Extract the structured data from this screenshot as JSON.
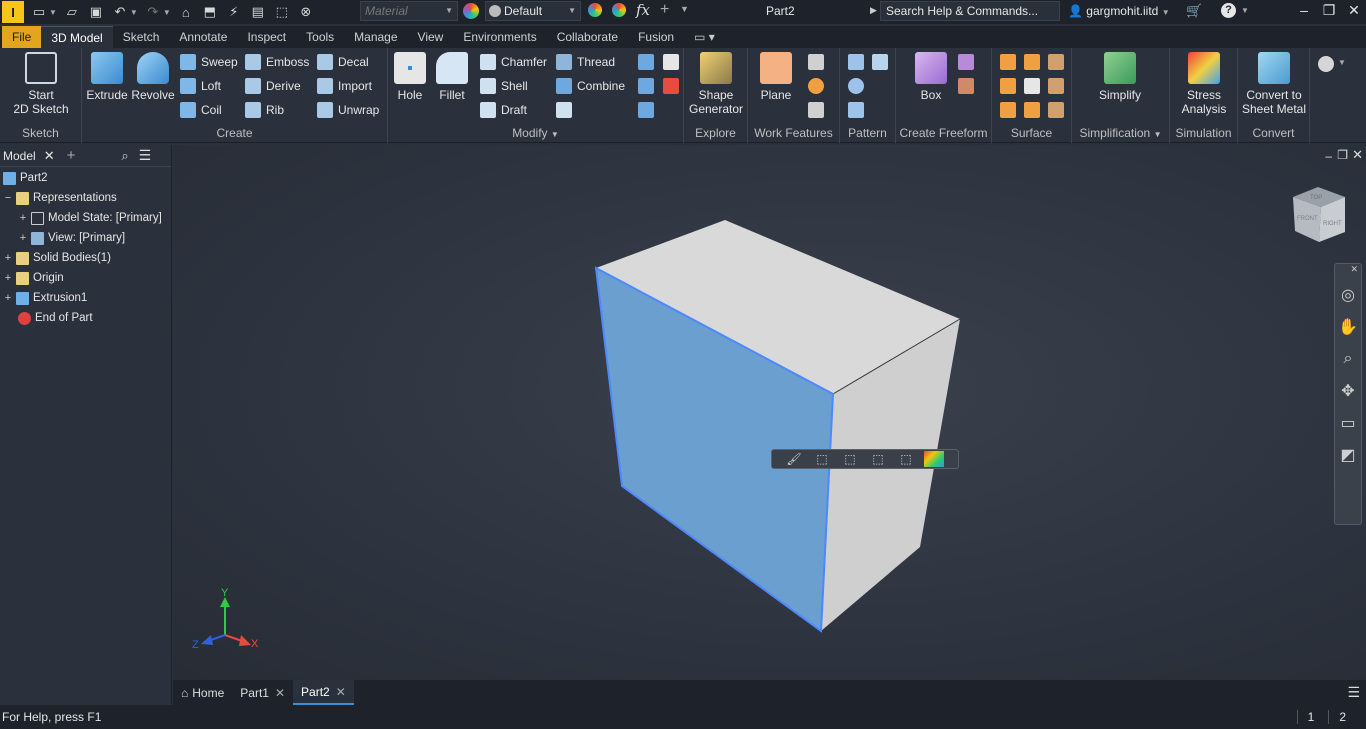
{
  "titlebar": {
    "material_placeholder": "Material",
    "appearance": "Default",
    "doc_title": "Part2",
    "search": "Search Help & Commands...",
    "user": "gargmohit.iitd",
    "fx": "fx"
  },
  "tabs": [
    "File",
    "3D Model",
    "Sketch",
    "Annotate",
    "Inspect",
    "Tools",
    "Manage",
    "View",
    "Environments",
    "Collaborate",
    "Fusion"
  ],
  "ribbon": {
    "sketch": {
      "label": "Sketch",
      "start": "Start",
      "sketch2d": "2D Sketch"
    },
    "create": {
      "label": "Create",
      "extrude": "Extrude",
      "revolve": "Revolve",
      "sweep": "Sweep",
      "loft": "Loft",
      "coil": "Coil",
      "emboss": "Emboss",
      "derive": "Derive",
      "rib": "Rib",
      "decal": "Decal",
      "import": "Import",
      "unwrap": "Unwrap"
    },
    "modify": {
      "label": "Modify",
      "hole": "Hole",
      "fillet": "Fillet",
      "chamfer": "Chamfer",
      "shell": "Shell",
      "draft": "Draft",
      "thread": "Thread",
      "combine": "Combine"
    },
    "explore": {
      "label": "Explore",
      "shape": "Shape",
      "generator": "Generator"
    },
    "work": {
      "label": "Work Features",
      "plane": "Plane"
    },
    "pattern": {
      "label": "Pattern"
    },
    "freeform": {
      "label": "Create Freeform",
      "box": "Box"
    },
    "surface": {
      "label": "Surface"
    },
    "simplification": {
      "label": "Simplification",
      "simplify": "Simplify"
    },
    "simulation": {
      "label": "Simulation",
      "stress": "Stress",
      "analysis": "Analysis"
    },
    "convert": {
      "label": "Convert",
      "convert_to": "Convert to",
      "sheet_metal": "Sheet Metal"
    }
  },
  "browser": {
    "title": "Model",
    "tree": [
      {
        "label": "Part2"
      },
      {
        "label": "Representations"
      },
      {
        "label": "Model State: [Primary]"
      },
      {
        "label": "View: [Primary]"
      },
      {
        "label": "Solid Bodies(1)"
      },
      {
        "label": "Origin"
      },
      {
        "label": "Extrusion1"
      },
      {
        "label": "End of Part"
      }
    ]
  },
  "viewport": {
    "axis_x": "X",
    "axis_y": "Y",
    "axis_z": "Z",
    "viewcube_top": "TOP",
    "viewcube_front": "FRONT",
    "viewcube_right": "RIGHT"
  },
  "doc_tabs": [
    "Home",
    "Part1",
    "Part2"
  ],
  "status": {
    "help": "For Help, press F1",
    "count1": "1",
    "count2": "2"
  },
  "colors": {
    "accent": "#e2a51b",
    "selected_face": "#6a9fd0",
    "face_light": "#d8d8d8",
    "face_side": "#cdcdcd"
  }
}
